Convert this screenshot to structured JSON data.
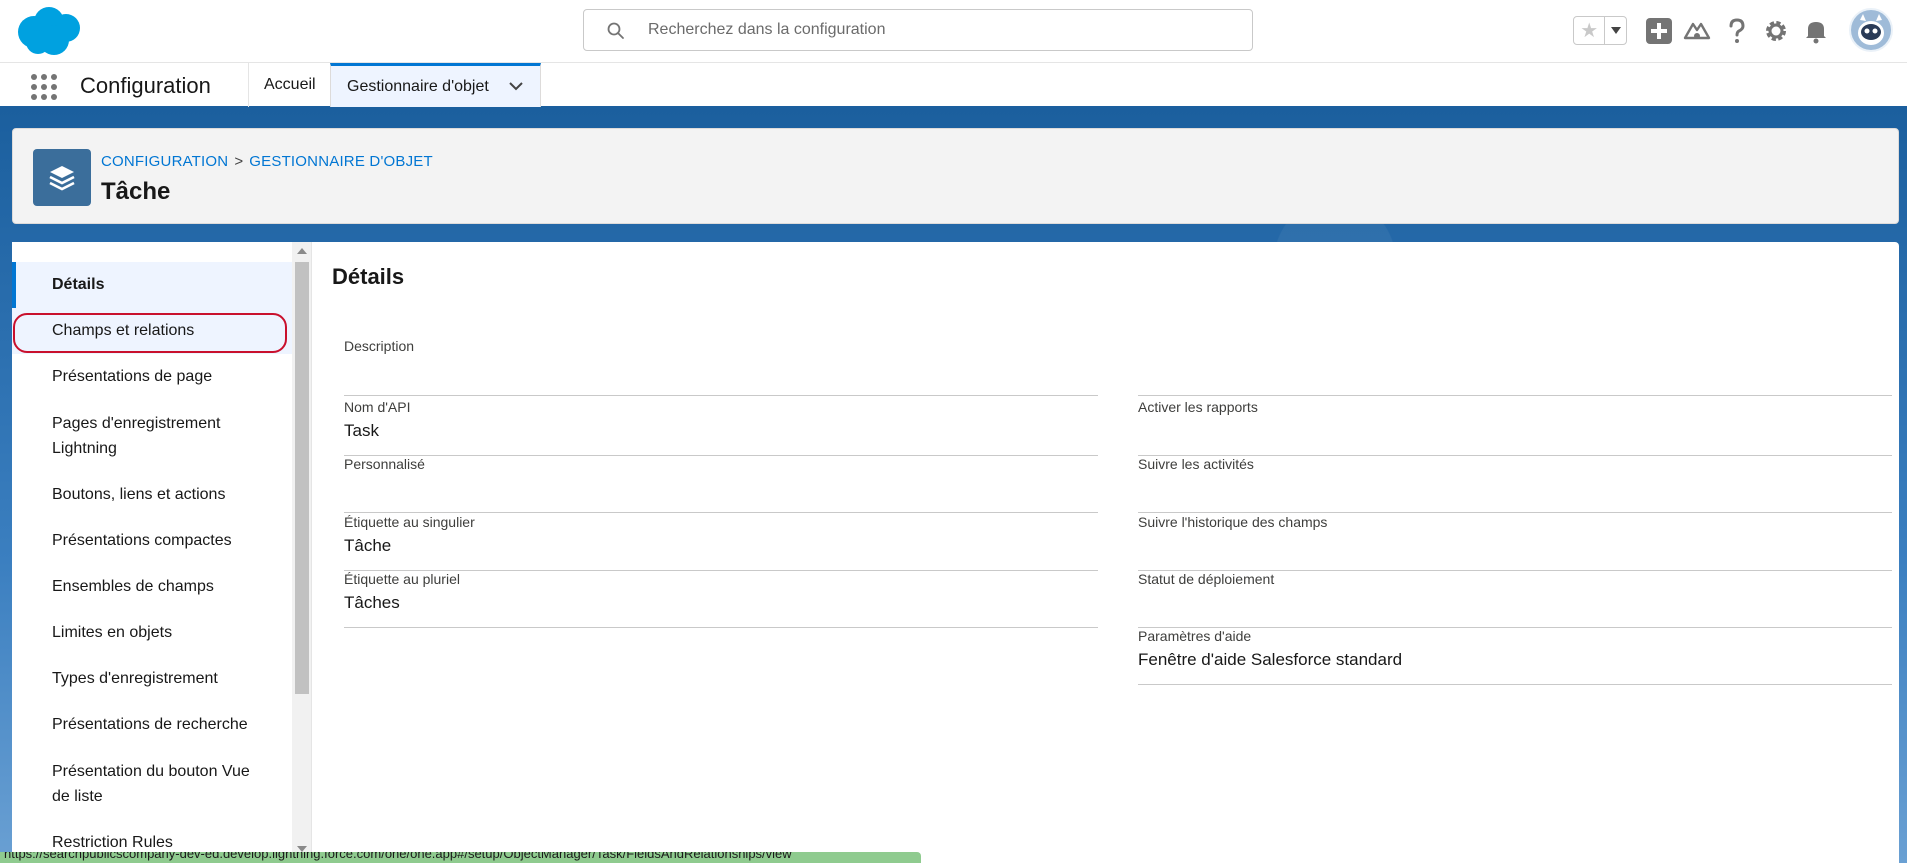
{
  "header": {
    "search_placeholder": "Recherchez dans la configuration"
  },
  "context_bar": {
    "app_name": "Configuration",
    "tabs": [
      {
        "label": "Accueil"
      },
      {
        "label": "Gestionnaire d'objet"
      }
    ]
  },
  "page_header": {
    "breadcrumb": [
      "CONFIGURATION",
      "GESTIONNAIRE D'OBJET"
    ],
    "breadcrumb_separator": ">",
    "title": "Tâche"
  },
  "sidebar": {
    "items": [
      {
        "label": "Détails"
      },
      {
        "label": "Champs et relations"
      },
      {
        "label": "Présentations de page"
      },
      {
        "label": "Pages d'enregistrement Lightning"
      },
      {
        "label": "Boutons, liens et actions"
      },
      {
        "label": "Présentations compactes"
      },
      {
        "label": "Ensembles de champs"
      },
      {
        "label": "Limites en objets"
      },
      {
        "label": "Types d'enregistrement"
      },
      {
        "label": "Présentations de recherche"
      },
      {
        "label": "Présentation du bouton Vue de liste"
      },
      {
        "label": "Restriction Rules"
      }
    ]
  },
  "main": {
    "section_title": "Détails",
    "left_fields": [
      {
        "label": "Description",
        "value": ""
      },
      {
        "label": "Nom d'API",
        "value": "Task"
      },
      {
        "label": "Personnalisé",
        "value": ""
      },
      {
        "label": "Étiquette au singulier",
        "value": "Tâche"
      },
      {
        "label": "Étiquette au pluriel",
        "value": "Tâches"
      }
    ],
    "right_fields": [
      {
        "label": "",
        "value": ""
      },
      {
        "label": "Activer les rapports",
        "value": ""
      },
      {
        "label": "Suivre les activités",
        "value": ""
      },
      {
        "label": "Suivre l'historique des champs",
        "value": ""
      },
      {
        "label": "Statut de déploiement",
        "value": ""
      },
      {
        "label": "Paramètres d'aide",
        "value": "Fenêtre d'aide Salesforce standard"
      }
    ]
  },
  "status_bar": {
    "url": "https://searchpublicscompany-dev-ed.develop.lightning.force.com/one/one.app#/setup/ObjectManager/Task/FieldsAndRelationships/view"
  },
  "colors": {
    "brand_blue": "#0176d3",
    "banner_blue": "#1b5f9e",
    "highlight_red": "#c9102d",
    "cloud_blue": "#00a1e0"
  }
}
